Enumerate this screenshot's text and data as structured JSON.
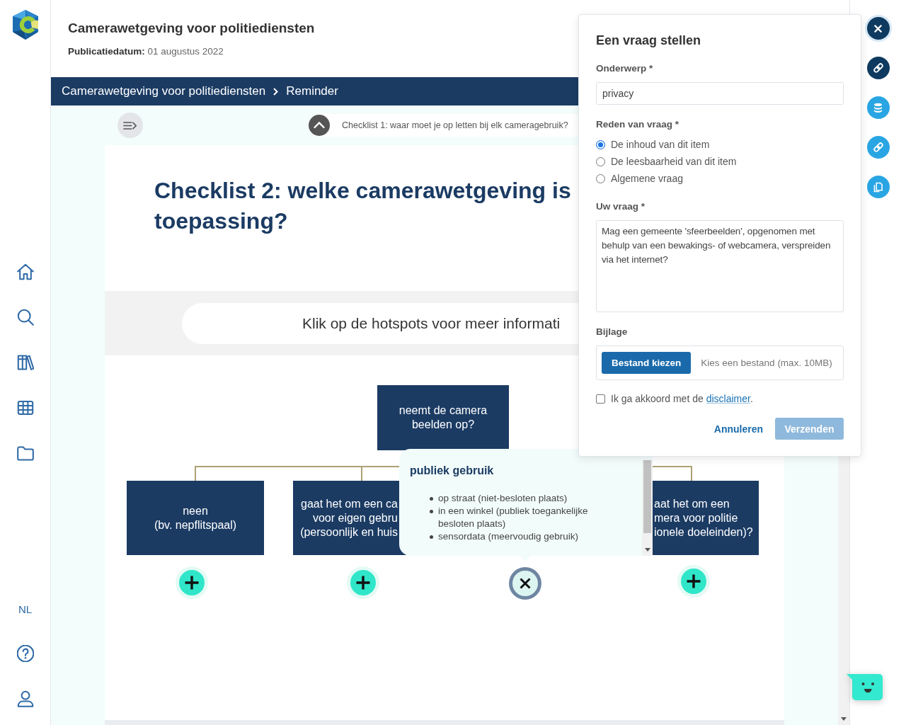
{
  "nav_rail": {
    "language": "NL"
  },
  "header": {
    "title": "Camerawetgeving voor politiediensten",
    "publication_date": "**Publicatiedatum:** 01 augustus 2022"
  },
  "breadcrumb": [
    "Camerawetgeving voor politiediensten",
    "Reminder"
  ],
  "toolbar": {
    "previous_chapter": "Checklist 1: waar moet je op letten bij elk cameragebruik?"
  },
  "content": {
    "heading_lines": [
      "Checklist 2: welke camerawetgeving is",
      "toepassing?"
    ],
    "instruction": "Klik op de hotspots voor meer informati",
    "diagram": {
      "root": [
        "neemt de camera",
        "beelden op?"
      ],
      "branches": [
        {
          "lines": [
            "neen",
            "(bv. nepflitspaal)"
          ],
          "expanded": false
        },
        {
          "lines": [
            "gaat het om een ca",
            "voor eigen gebru",
            "(persoonlijk en huis"
          ],
          "expanded": false
        },
        {
          "expanded": true
        },
        {
          "lines": [
            "aat het om een",
            "mera voor politie",
            "ionele doeleinden)?"
          ],
          "expanded": false
        }
      ],
      "popup": {
        "title": "publiek gebruik",
        "items": [
          "op straat (niet-besloten plaats)",
          "in een winkel (publiek toegankelijke besloten plaats)",
          "sensordata (meervoudig gebruik)"
        ]
      }
    }
  },
  "question_dialog": {
    "title": "Een vraag stellen",
    "subject": {
      "label": "Onderwerp *",
      "value": "privacy"
    },
    "reason": {
      "label": "Reden van vraag *",
      "options": [
        {
          "label": "De inhoud van dit item",
          "selected": true
        },
        {
          "label": "De leesbaarheid van dit item",
          "selected": false
        },
        {
          "label": "Algemene vraag",
          "selected": false
        }
      ]
    },
    "question": {
      "label": "Uw vraag *",
      "value": "Mag een gemeente 'sfeerbeelden', opgenomen met behulp van een bewakings- of webcamera, verspreiden via het internet?"
    },
    "attachment": {
      "label": "Bijlage",
      "button": "Bestand kiezen",
      "placeholder": "Kies een bestand (max. 10MB)"
    },
    "consent": {
      "checked": false,
      "text": "Ik ga akkoord met de",
      "link": "disclaimer",
      "after": "."
    },
    "actions": [
      {
        "label": "Annuleren",
        "kind": "link",
        "disabled": false
      },
      {
        "label": "Verzenden",
        "kind": "primary",
        "disabled": true
      }
    ]
  }
}
